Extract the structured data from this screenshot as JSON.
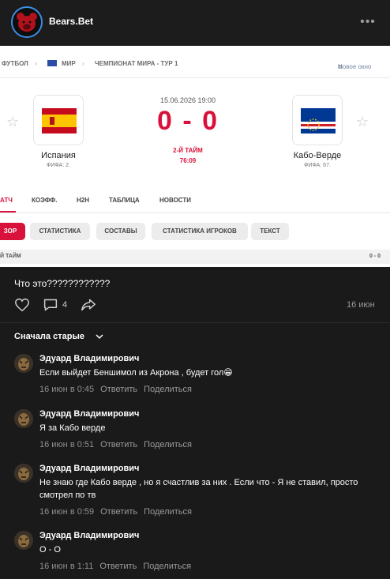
{
  "header": {
    "channel_name": "Bears.Bet",
    "more_icon": "more-horizontal-icon"
  },
  "screenshot": {
    "breadcrumb": {
      "sport": "ФУТБОЛ",
      "region": "МИР",
      "tournament": "ЧЕМПИОНАТ МИРА - ТУР 1",
      "new_window": "Новое окно"
    },
    "match": {
      "date": "15.06.2026 19:00",
      "score": "0 - 0",
      "period": "2-Й ТАЙМ",
      "minute": "76:09",
      "home": {
        "name": "Испания",
        "rank": "ФИФА: 2."
      },
      "away": {
        "name": "Кабо-Верде",
        "rank": "ФИФА: 67."
      }
    },
    "tabs": [
      "АТЧ",
      "КОЭФФ.",
      "H2H",
      "ТАБЛИЦА",
      "НОВОСТИ"
    ],
    "subtabs": [
      "ЗОР",
      "СТАТИСТИКА",
      "СОСТАВЫ",
      "СТАТИСТИКА ИГРОКОВ",
      "ТЕКСТ"
    ],
    "period_bar": {
      "label": "Й ТАЙМ",
      "score": "0 - 0"
    }
  },
  "post": {
    "text": "Что это????????????",
    "comment_count": "4",
    "date": "16 июн"
  },
  "sort_label": "Сначала старые",
  "comments": [
    {
      "author": "Эдуард Владимирович",
      "text": "Если выйдет Беншимол из Акрона , будет гол😁",
      "time": "16 июн в 0:45",
      "reply": "Ответить",
      "share": "Поделиться"
    },
    {
      "author": "Эдуард Владимирович",
      "text": "Я за Кабо верде",
      "time": "16 июн в 0:51",
      "reply": "Ответить",
      "share": "Поделиться"
    },
    {
      "author": "Эдуард Владимирович",
      "text": "Не знаю где Кабо верде , но я счастлив за них . Если что - Я не ставил, просто смотрел по тв",
      "time": "16 июн в 0:59",
      "reply": "Ответить",
      "share": "Поделиться"
    },
    {
      "author": "Эдуард Владимирович",
      "text": "О - О",
      "time": "16 июн в 1:11",
      "reply": "Ответить",
      "share": "Поделиться"
    }
  ],
  "colors": {
    "background": "#1a1a1a",
    "accent_red": "#d8123a",
    "avatar_ring": "#3b8fe6"
  }
}
